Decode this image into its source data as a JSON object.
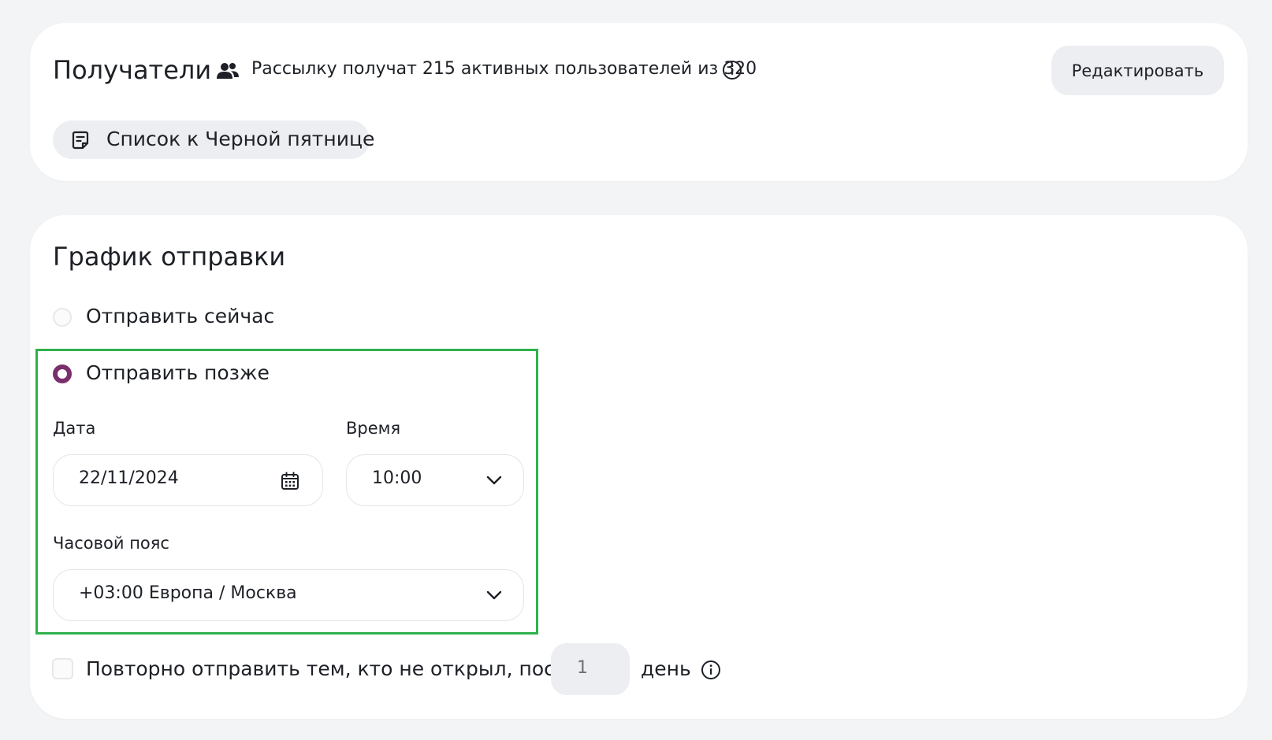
{
  "recipients": {
    "title": "Получатели",
    "summary": "Рассылку получат 215 активных пользователей из 320",
    "edit_button": "Редактировать",
    "list_chip": "Список к Черной пятнице"
  },
  "schedule": {
    "title": "График отправки",
    "options": [
      {
        "label": "Отправить сейчас",
        "selected": false
      },
      {
        "label": "Отправить позже",
        "selected": true
      }
    ],
    "date": {
      "label": "Дата",
      "value": "22/11/2024"
    },
    "time": {
      "label": "Время",
      "value": "10:00"
    },
    "timezone": {
      "label": "Часовой пояс",
      "value": "+03:00 Европа / Москва"
    },
    "resend": {
      "label": "Повторно отправить тем, кто не открыл, после",
      "checked": false,
      "value": "1",
      "unit": "день"
    }
  },
  "colors": {
    "accent": "#7a2f6b",
    "highlight": "#2fb14c",
    "card_bg": "#ffffff",
    "page_bg": "#f3f4f6",
    "button_bg": "#eceef1"
  },
  "icons": {
    "users": "users-icon",
    "info": "info-icon",
    "list": "document-list-icon",
    "calendar": "calendar-icon",
    "chevron": "chevron-down-icon"
  }
}
